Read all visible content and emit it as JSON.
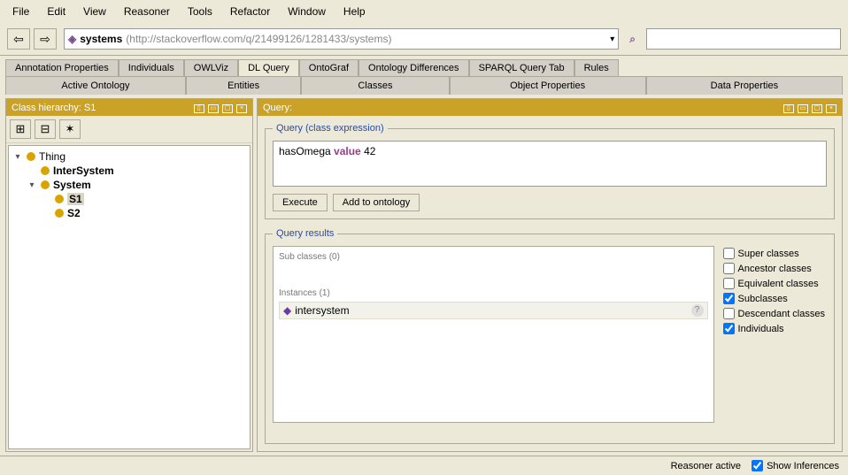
{
  "menu": {
    "items": [
      "File",
      "Edit",
      "View",
      "Reasoner",
      "Tools",
      "Refactor",
      "Window",
      "Help"
    ]
  },
  "nav": {
    "back": "⇦",
    "forward": "⇨",
    "ontology_icon": "◈",
    "ontology_name": "systems",
    "ontology_iri": "(http://stackoverflow.com/q/21499126/1281433/systems)",
    "dropdown": "▾",
    "search_icon": "⌕"
  },
  "tabs_row1": [
    "Annotation Properties",
    "Individuals",
    "OWLViz",
    "DL Query",
    "OntoGraf",
    "Ontology Differences",
    "SPARQL Query Tab",
    "Rules"
  ],
  "tabs_row1_active": 3,
  "tabs_row2": [
    "Active Ontology",
    "Entities",
    "Classes",
    "Object Properties",
    "Data Properties"
  ],
  "left": {
    "header": "Class hierarchy: S1",
    "toolbar": [
      "⊞",
      "⊟",
      "✶"
    ],
    "tree": [
      {
        "label": "Thing",
        "indent": 0,
        "bold": false,
        "expander": "▾",
        "selected": false
      },
      {
        "label": "InterSystem",
        "indent": 1,
        "bold": true,
        "expander": "",
        "selected": false
      },
      {
        "label": "System",
        "indent": 1,
        "bold": true,
        "expander": "▾",
        "selected": false
      },
      {
        "label": "S1",
        "indent": 2,
        "bold": true,
        "expander": "",
        "selected": true
      },
      {
        "label": "S2",
        "indent": 2,
        "bold": true,
        "expander": "",
        "selected": false
      }
    ]
  },
  "right": {
    "header": "Query:",
    "legend_query": "Query (class expression)",
    "query_html": "hasOmega <b style='color:#9a3a8a'>value</b> 42",
    "btn_execute": "Execute",
    "btn_add": "Add to ontology",
    "legend_results": "Query results",
    "subclasses_label": "Sub classes (0)",
    "instances_label": "Instances (1)",
    "instance": "intersystem",
    "qmark": "?",
    "checks": [
      {
        "label": "Super classes",
        "checked": false
      },
      {
        "label": "Ancestor classes",
        "checked": false
      },
      {
        "label": "Equivalent classes",
        "checked": false
      },
      {
        "label": "Subclasses",
        "checked": true
      },
      {
        "label": "Descendant classes",
        "checked": false
      },
      {
        "label": "Individuals",
        "checked": true
      }
    ]
  },
  "status": {
    "reasoner": "Reasoner active",
    "show_inf_label": "Show Inferences",
    "show_inf": true
  }
}
